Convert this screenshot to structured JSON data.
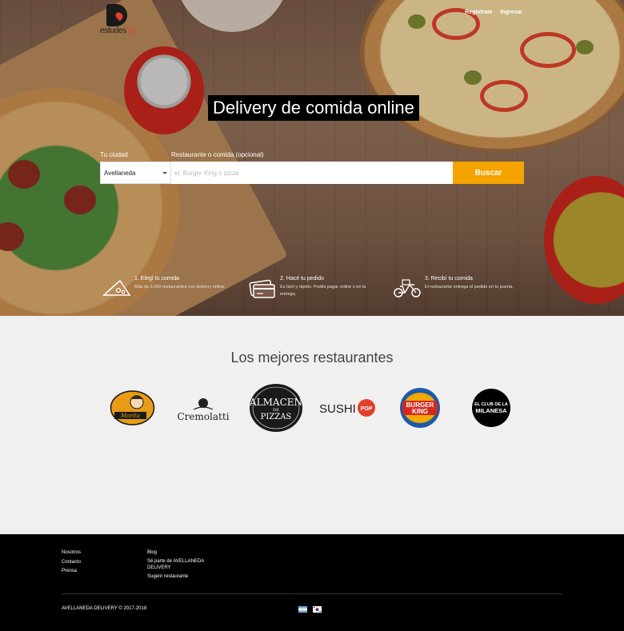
{
  "brand": {
    "logo_text": "estudes",
    "logo_accent": "10"
  },
  "topnav": {
    "register": "Registrate",
    "login": "Ingresar"
  },
  "hero": {
    "headline": "Delivery de comida online"
  },
  "search": {
    "city_label": "Tu ciudad",
    "city_value": "Avellaneda",
    "query_label": "Restaurante o comida (opcional)",
    "query_placeholder": "ej: Burger King o pizza",
    "button": "Buscar"
  },
  "steps": [
    {
      "title": "1. Elegí tu comida",
      "desc": "Más de 3.000 restaurantes con delivery online.",
      "icon": "pizza-icon"
    },
    {
      "title": "2. Hacé tu pedido",
      "desc": "Es fácil y rápido. Podés pagar online o en la entrega.",
      "icon": "card-icon"
    },
    {
      "title": "3. Recibí tu comida",
      "desc": "El restaurante entrega el pedido en tu puerta.",
      "icon": "bike-icon"
    }
  ],
  "restaurants": {
    "title": "Los mejores restaurantes",
    "items": [
      {
        "name": "Morita",
        "logo": "morita-logo"
      },
      {
        "name": "Cremolatti",
        "logo": "cremolatti-logo"
      },
      {
        "name": "Almacén de Pizzas",
        "logo": "almacen-logo",
        "text": "ALMACEN",
        "sub": "DE",
        "text2": "PIZZAS"
      },
      {
        "name": "Sushi Pop",
        "logo": "sushipop-logo",
        "text": "SUSHI",
        "sub": "POP"
      },
      {
        "name": "Burger King",
        "logo": "burgerking-logo",
        "text": "BURGER",
        "text2": "KING"
      },
      {
        "name": "El Club de la Milanesa",
        "logo": "milanesa-logo",
        "text": "EL CLUB DE LA",
        "text2": "MILANESA"
      }
    ]
  },
  "footer": {
    "col1": [
      "Nosotros",
      "Contacto",
      "Prensa"
    ],
    "col2": [
      "Blog",
      "Sé parte de AVELLANEDA DELIVERY",
      "Sugerir restaurante"
    ],
    "copyright": "AVELLANEDA DELIVERY © 2017-2018"
  },
  "colors": {
    "accent": "#f5a300",
    "footer_bg": "#000000",
    "section_bg": "#f0f0f0"
  }
}
